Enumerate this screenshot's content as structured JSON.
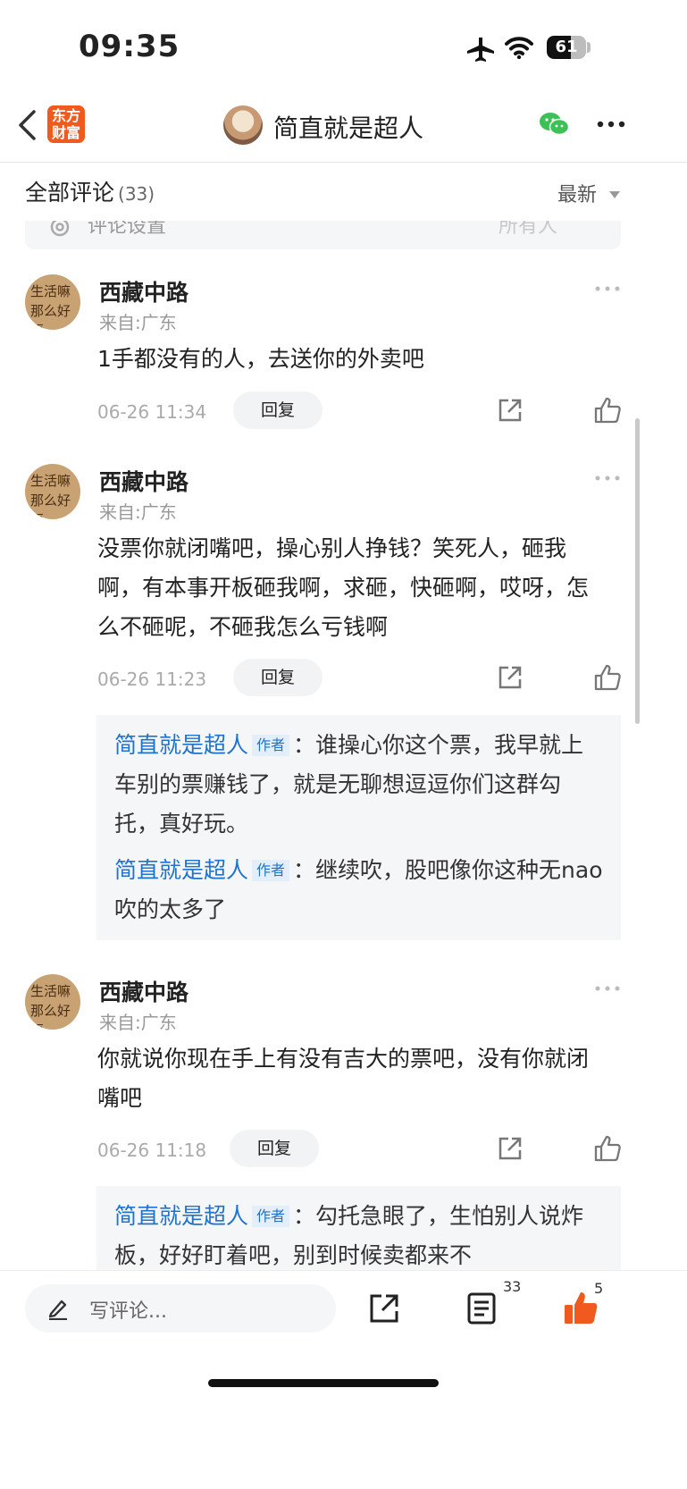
{
  "status_bar": {
    "time": "09:35",
    "battery": "61",
    "battery_level": 0.61
  },
  "nav": {
    "logo_line1": "东方",
    "logo_line2": "财富",
    "title": "简直就是超人",
    "icons": {
      "back": "chevron-left-icon",
      "share_wechat": "wechat-icon",
      "more": "more-horizontal-icon"
    },
    "colors": {
      "logo": "#f05a1f",
      "wechat": "#3dc055"
    }
  },
  "header": {
    "title": "全部评论",
    "count": "(33)",
    "sort": "最新"
  },
  "settings_strip": {
    "label": "评论设置",
    "value": "所有人"
  },
  "comments": [
    {
      "user": "西藏中路",
      "avatar_text": "生活嘛那么好悟",
      "from": "来自:广东",
      "text": "1手都没有的人，去送你的外卖吧",
      "date": "06-26 11:34",
      "reply_label": "回复"
    },
    {
      "user": "西藏中路",
      "avatar_text": "生活嘛那么好悟",
      "from": "来自:广东",
      "text": "没票你就闭嘴吧，操心别人挣钱？笑死人，砸我啊，有本事开板砸我啊，求砸，快砸啊，哎呀，怎么不砸呢，不砸我怎么亏钱啊",
      "date": "06-26 11:23",
      "reply_label": "回复",
      "replies": [
        {
          "author": "简直就是超人",
          "tag": "作者",
          "text": "：谁操心你这个票，我早就上车别的票赚钱了，就是无聊想逗逗你们这群勾托，真好玩。"
        },
        {
          "author": "简直就是超人",
          "tag": "作者",
          "text": "：继续吹，股吧像你这种无nao吹的太多了"
        }
      ]
    },
    {
      "user": "西藏中路",
      "avatar_text": "生活嘛那么好悟",
      "from": "来自:广东",
      "text": "你就说你现在手上有没有吉大的票吧，没有你就闭嘴吧",
      "date": "06-26 11:18",
      "reply_label": "回复",
      "replies": [
        {
          "author": "简直就是超人",
          "tag": "作者",
          "text": "：勾托急眼了，生怕别人说炸板，好好盯着吧，别到时候卖都来不"
        }
      ]
    }
  ],
  "bottom_bar": {
    "placeholder": "写评论...",
    "comment_count": "33",
    "like_count": "5",
    "colors": {
      "like": "#f05a1f"
    }
  }
}
